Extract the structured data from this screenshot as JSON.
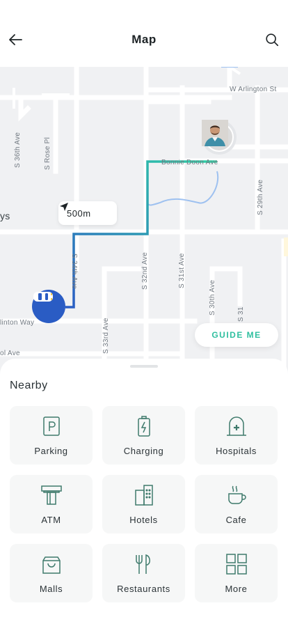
{
  "header": {
    "title": "Map",
    "back_icon": "arrow-left-icon",
    "search_icon": "search-icon"
  },
  "map": {
    "streets": {
      "w_arlington": "W Arlington St",
      "s_36th": "S 36th Ave",
      "s_rose": "S Rose Pl",
      "bonnie_doon": "Bonnie Doon Ave",
      "s_29th": "S 29th Ave",
      "ys": "ys",
      "s_34th": "S 34th Ave",
      "s_32nd": "S 32nd Ave",
      "s_31st": "S 31st Ave",
      "s_33rd": "S 33rd Ave",
      "s_30th": "S 30th Ave",
      "s_31": "S 31",
      "lnton_way": "linton Way",
      "ol_ave": "ol Ave"
    },
    "distance": "500m",
    "route_colors": {
      "start": "#2a5cc4",
      "end": "#2fd3a5"
    },
    "guide_button": "GUIDE ME"
  },
  "sheet": {
    "title": "Nearby",
    "items": [
      {
        "label": "Parking",
        "icon": "parking-icon"
      },
      {
        "label": "Charging",
        "icon": "charging-icon"
      },
      {
        "label": "Hospitals",
        "icon": "hospital-icon"
      },
      {
        "label": "ATM",
        "icon": "atm-icon"
      },
      {
        "label": "Hotels",
        "icon": "hotel-icon"
      },
      {
        "label": "Cafe",
        "icon": "cafe-icon"
      },
      {
        "label": "Malls",
        "icon": "mall-icon"
      },
      {
        "label": "Restaurants",
        "icon": "restaurant-icon"
      },
      {
        "label": "More",
        "icon": "more-grid-icon"
      }
    ]
  },
  "colors": {
    "accent": "#2fbf9f",
    "icon": "#3f7a6c",
    "pin": "#2a5cc4"
  }
}
